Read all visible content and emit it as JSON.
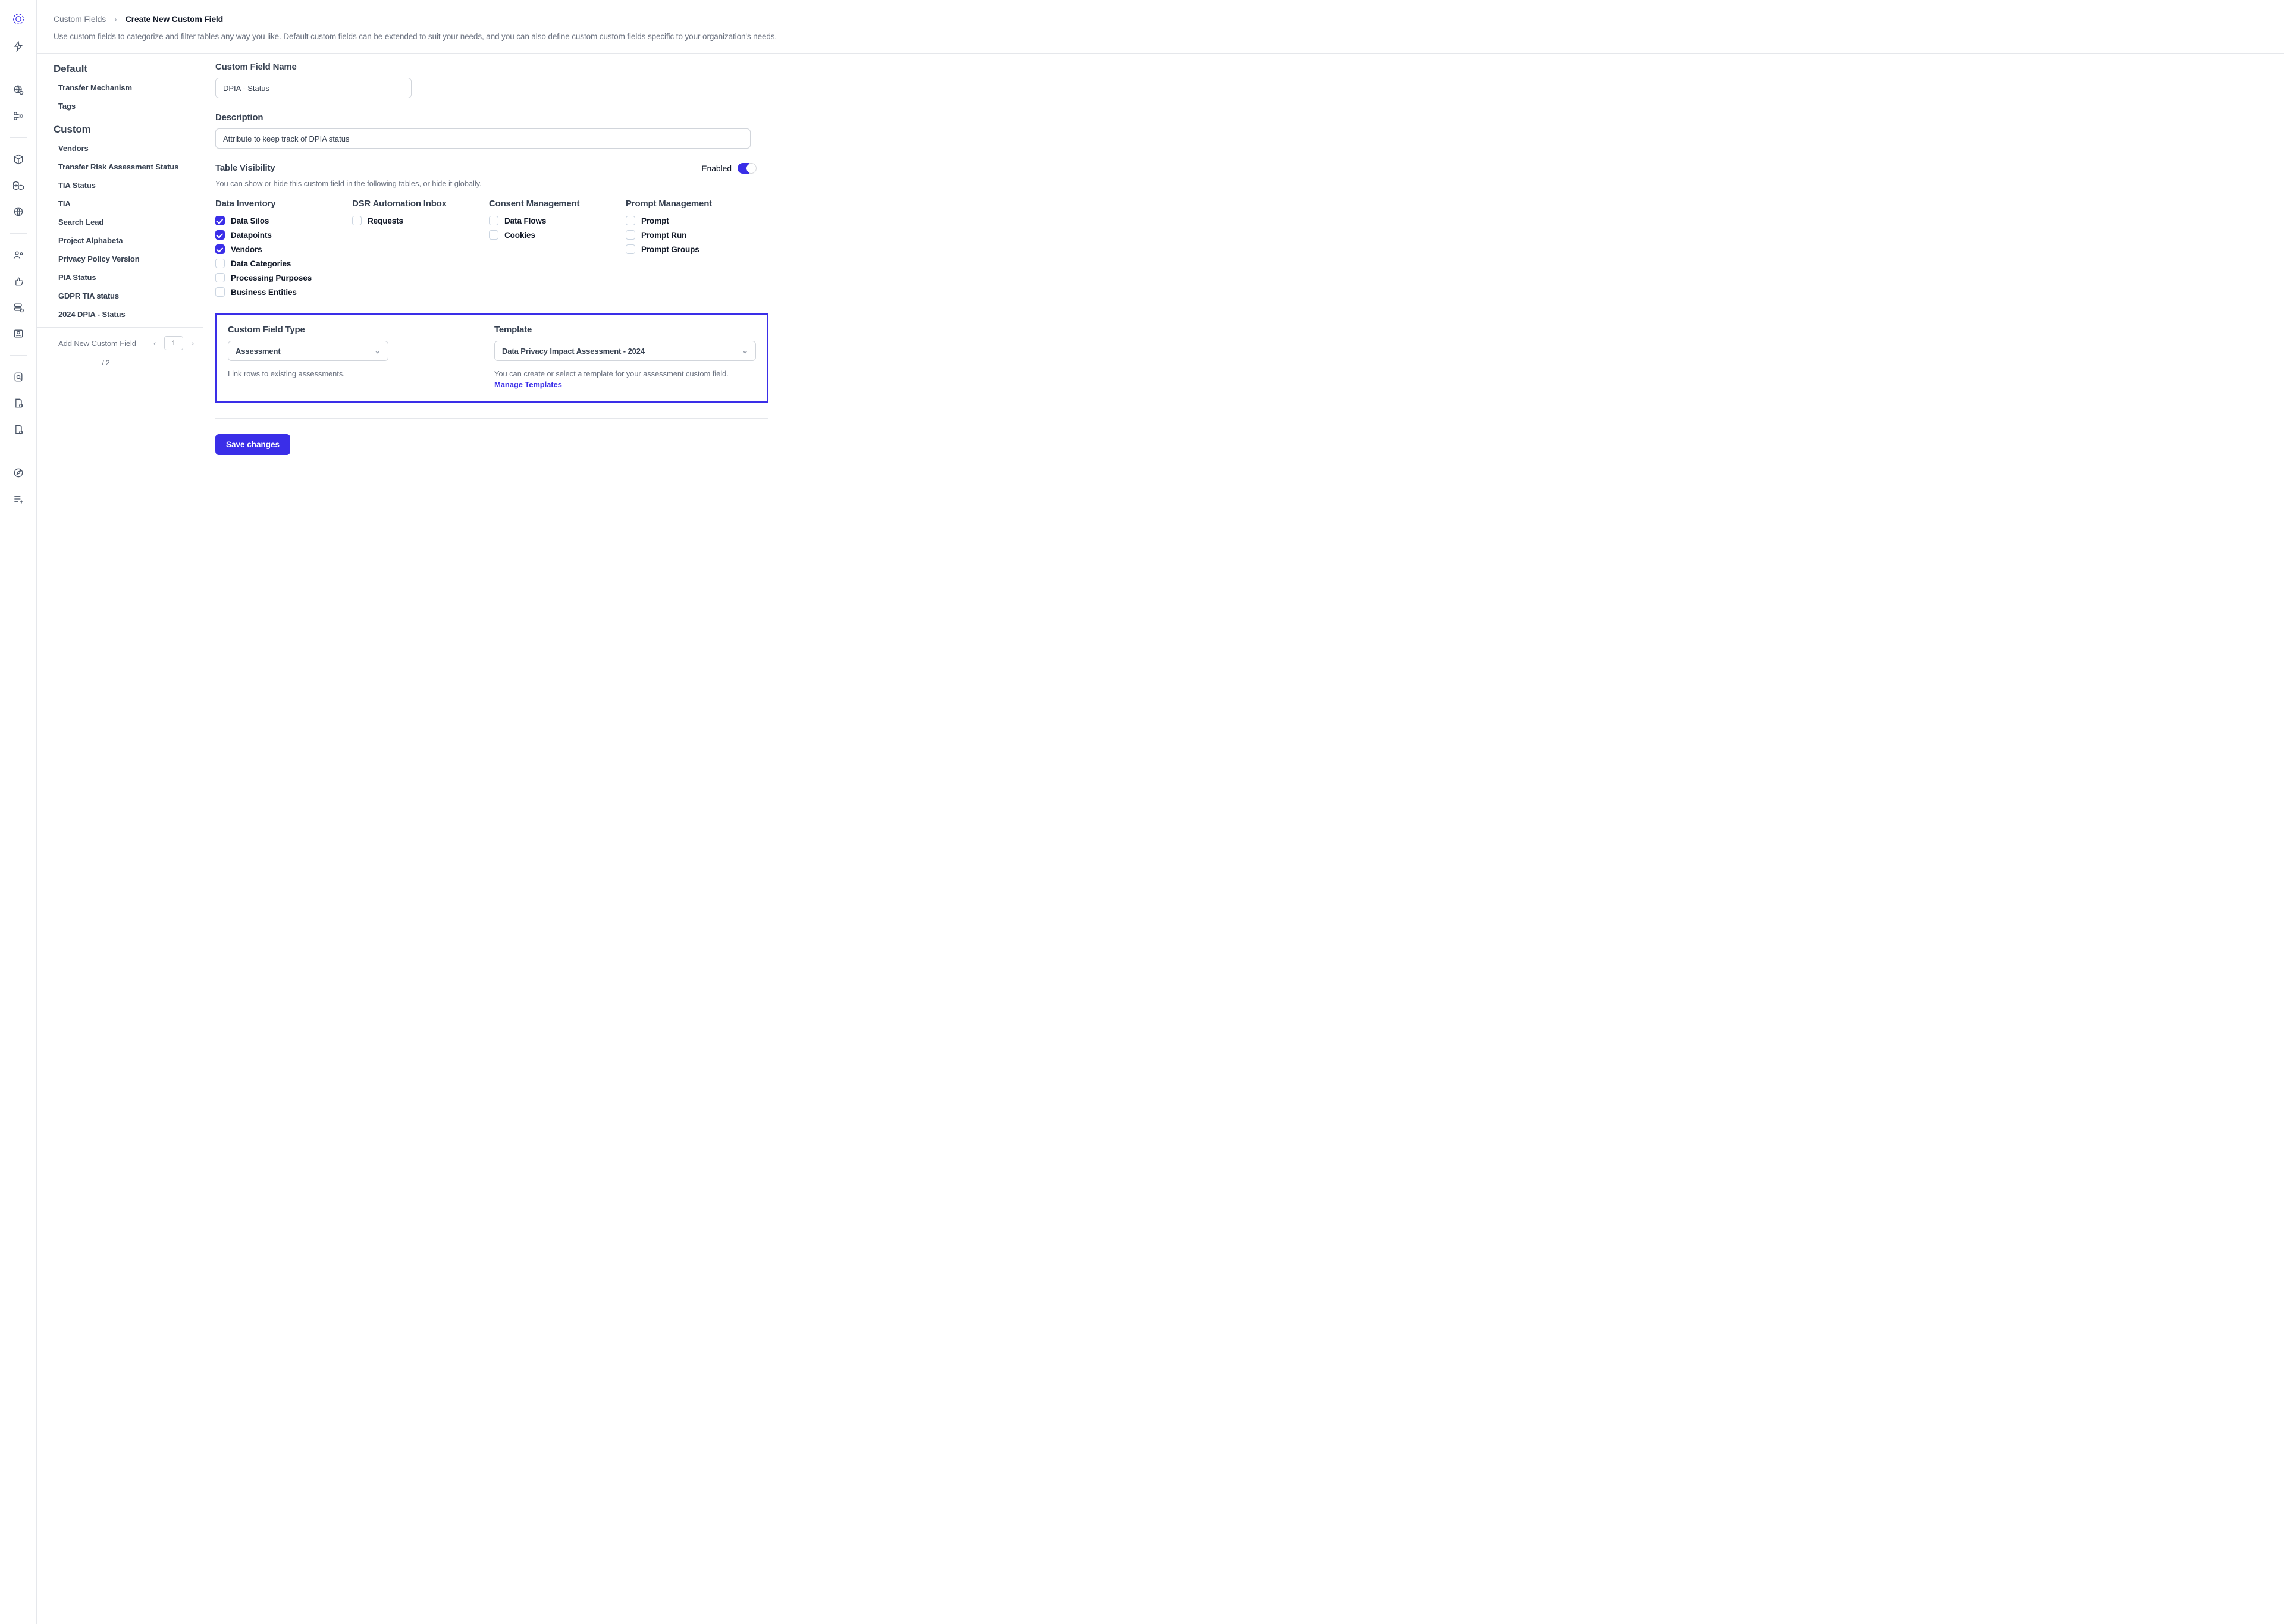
{
  "breadcrumb": {
    "root": "Custom Fields",
    "current": "Create New Custom Field"
  },
  "header_desc": "Use custom fields to categorize and filter tables any way you like. Default custom fields can be extended to suit your needs, and you can also define custom custom fields specific to your organization's needs.",
  "side": {
    "default_title": "Default",
    "default_items": [
      "Transfer Mechanism",
      "Tags"
    ],
    "custom_title": "Custom",
    "custom_items": [
      "Vendors",
      "Transfer Risk Assessment Status",
      "TIA Status",
      "TIA",
      "Search Lead",
      "Project Alphabeta",
      "Privacy Policy Version",
      "PIA Status",
      "GDPR TIA status",
      "2024 DPIA - Status"
    ],
    "add_label": "Add New Custom Field",
    "page_current": "1",
    "page_total": "/   2"
  },
  "form": {
    "name_label": "Custom Field Name",
    "name_value": "DPIA - Status",
    "desc_label": "Description",
    "desc_value": "Attribute to keep track of DPIA status",
    "vis_label": "Table Visibility",
    "vis_sub": "You can show or hide this custom field in the following tables, or hide it globally.",
    "enabled_label": "Enabled"
  },
  "visibility": {
    "col1_title": "Data Inventory",
    "col1": [
      {
        "label": "Data Silos",
        "checked": true
      },
      {
        "label": "Datapoints",
        "checked": true
      },
      {
        "label": "Vendors",
        "checked": true
      },
      {
        "label": "Data Categories",
        "checked": false
      },
      {
        "label": "Processing Purposes",
        "checked": false
      },
      {
        "label": "Business Entities",
        "checked": false
      }
    ],
    "col2_title": "DSR Automation Inbox",
    "col2": [
      {
        "label": "Requests",
        "checked": false
      }
    ],
    "col3_title": "Consent Management",
    "col3": [
      {
        "label": "Data Flows",
        "checked": false
      },
      {
        "label": "Cookies",
        "checked": false
      }
    ],
    "col4_title": "Prompt Management",
    "col4": [
      {
        "label": "Prompt",
        "checked": false
      },
      {
        "label": "Prompt Run",
        "checked": false
      },
      {
        "label": "Prompt Groups",
        "checked": false
      }
    ]
  },
  "type_section": {
    "type_label": "Custom Field Type",
    "type_value": "Assessment",
    "type_sub": "Link rows to existing assessments.",
    "template_label": "Template",
    "template_value": "Data Privacy Impact Assessment - 2024",
    "template_sub": "You can create or select a template for your assessment custom field.",
    "manage_link": "Manage Templates"
  },
  "save_label": "Save changes"
}
